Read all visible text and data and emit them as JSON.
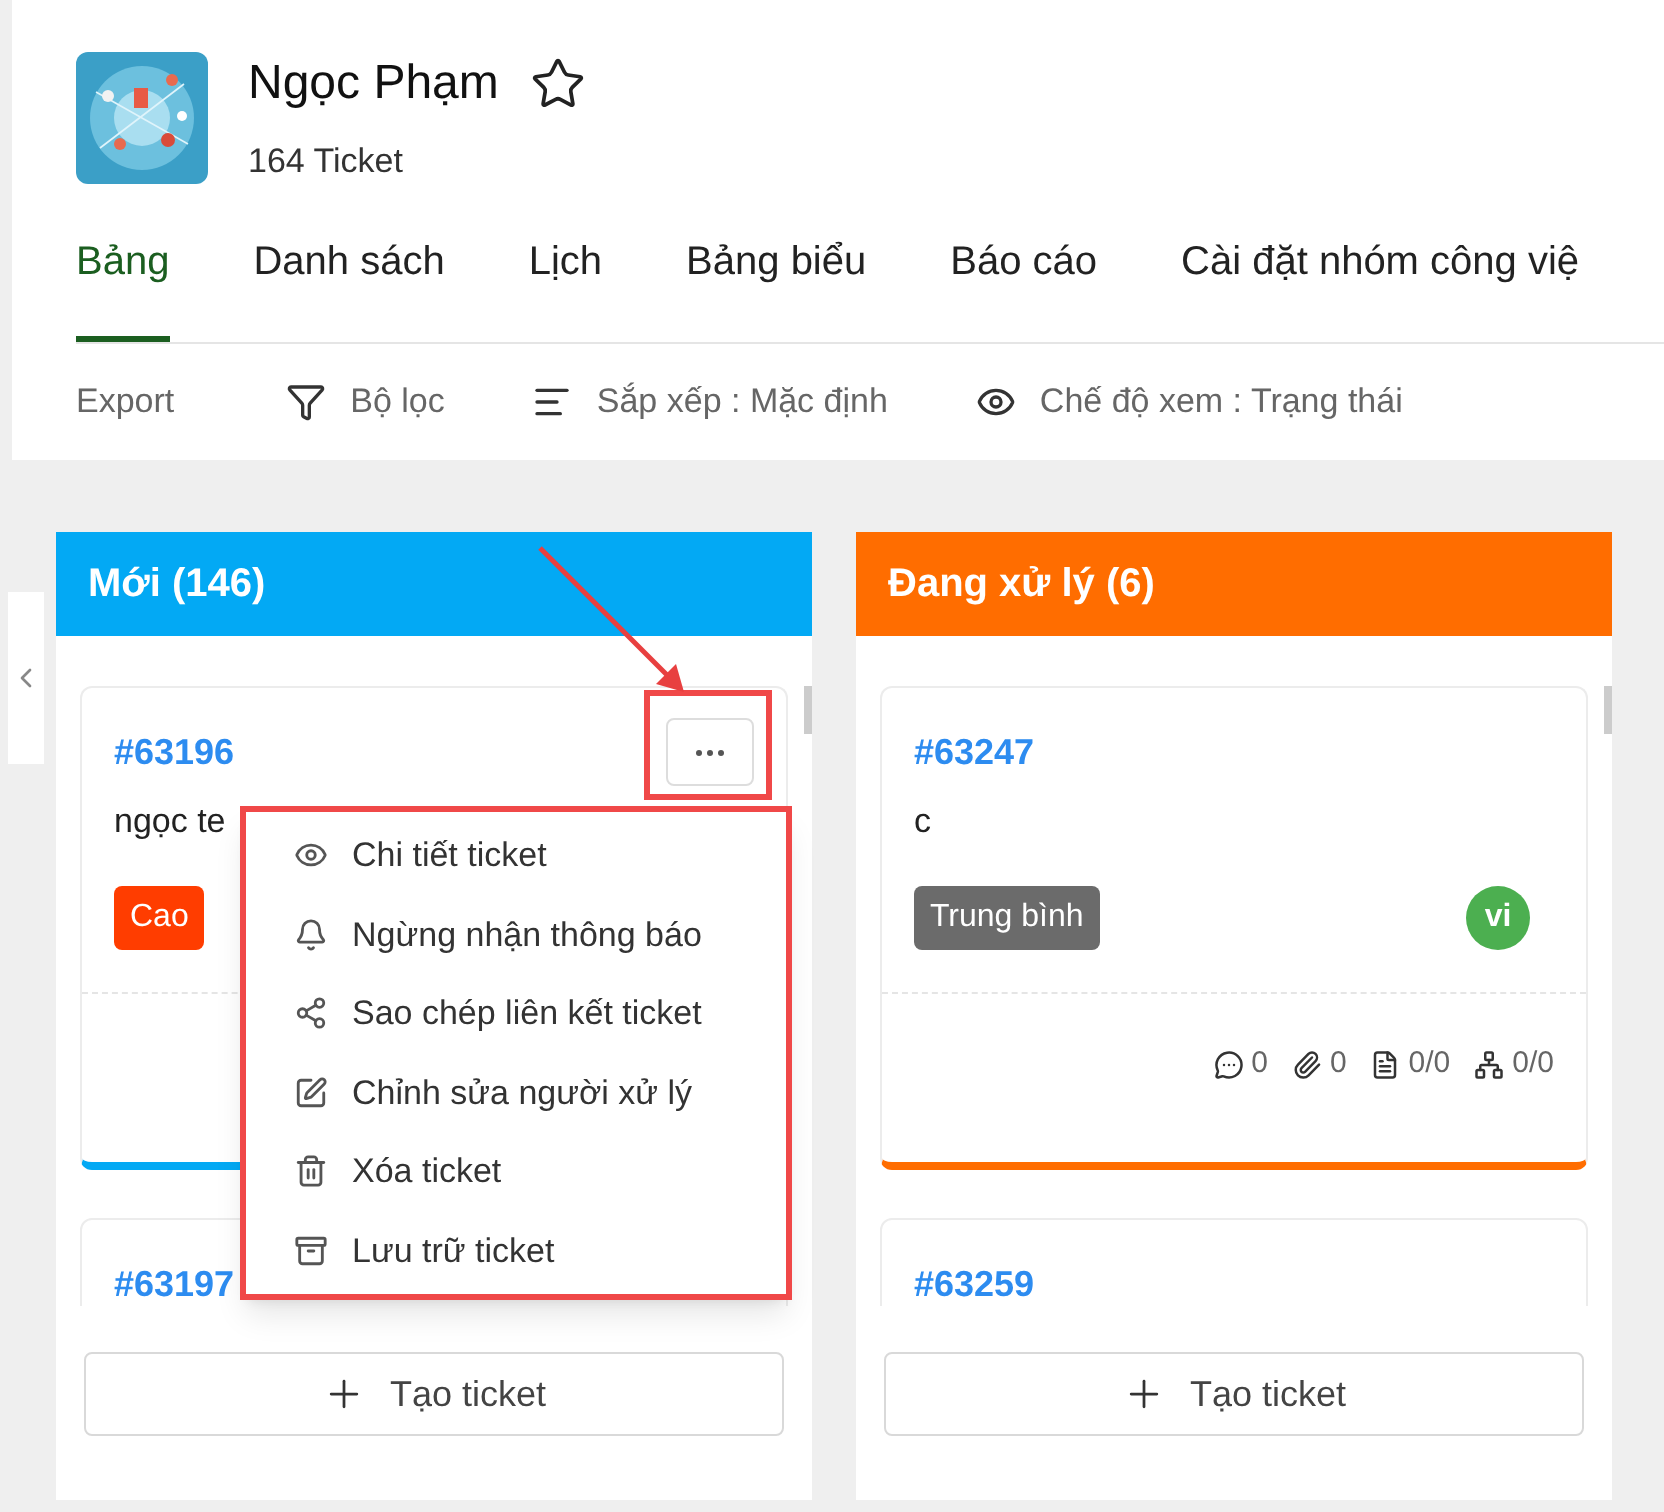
{
  "project": {
    "name": "Ngọc Phạm",
    "count": "164 Ticket"
  },
  "tabs": [
    {
      "label": "Bảng",
      "selected": true
    },
    {
      "label": "Danh sách",
      "selected": false
    },
    {
      "label": "Lịch",
      "selected": false
    },
    {
      "label": "Bảng biểu",
      "selected": false
    },
    {
      "label": "Báo cáo",
      "selected": false
    },
    {
      "label": "Cài đặt nhóm công việ",
      "selected": false
    }
  ],
  "toolbar": [
    {
      "kind": "export",
      "label": "Export"
    },
    {
      "kind": "filter",
      "label": "Bộ lọc"
    },
    {
      "kind": "sort",
      "label": "Sắp xếp : Mặc định"
    },
    {
      "kind": "view",
      "label": "Chế độ xem : Trạng thái"
    }
  ],
  "columns": [
    {
      "title": "Mới (146)",
      "color": "#03a9f4",
      "create_label": "Tạo ticket",
      "cards": [
        {
          "id": "#63196",
          "text": "ngọc te",
          "priority": "Cao",
          "color": "#ff3d00",
          "menu_open": true
        },
        {
          "id": "#63197"
        }
      ]
    },
    {
      "title": "Đang xử lý (6)",
      "color": "#ff6d00",
      "create_label": "Tạo ticket",
      "cards": [
        {
          "id": "#63247",
          "text": "c",
          "priority": "Trung bình",
          "color": "#6b6b6b",
          "assignee": "vi",
          "stats": [
            {
              "kind": "comments",
              "value": "0"
            },
            {
              "kind": "attachments",
              "value": "0"
            },
            {
              "kind": "files",
              "value": "0/0"
            },
            {
              "kind": "subtasks",
              "value": "0/0"
            }
          ]
        },
        {
          "id": "#63259"
        }
      ]
    }
  ],
  "context_menu": [
    {
      "kind": "view",
      "label": "Chi tiết ticket"
    },
    {
      "kind": "unfollow",
      "label": "Ngừng nhận thông báo"
    },
    {
      "kind": "share",
      "label": "Sao chép liên kết ticket"
    },
    {
      "kind": "edit",
      "label": "Chỉnh sửa người xử lý"
    },
    {
      "kind": "delete",
      "label": "Xóa ticket"
    },
    {
      "kind": "archive",
      "label": "Lưu trữ ticket"
    }
  ]
}
